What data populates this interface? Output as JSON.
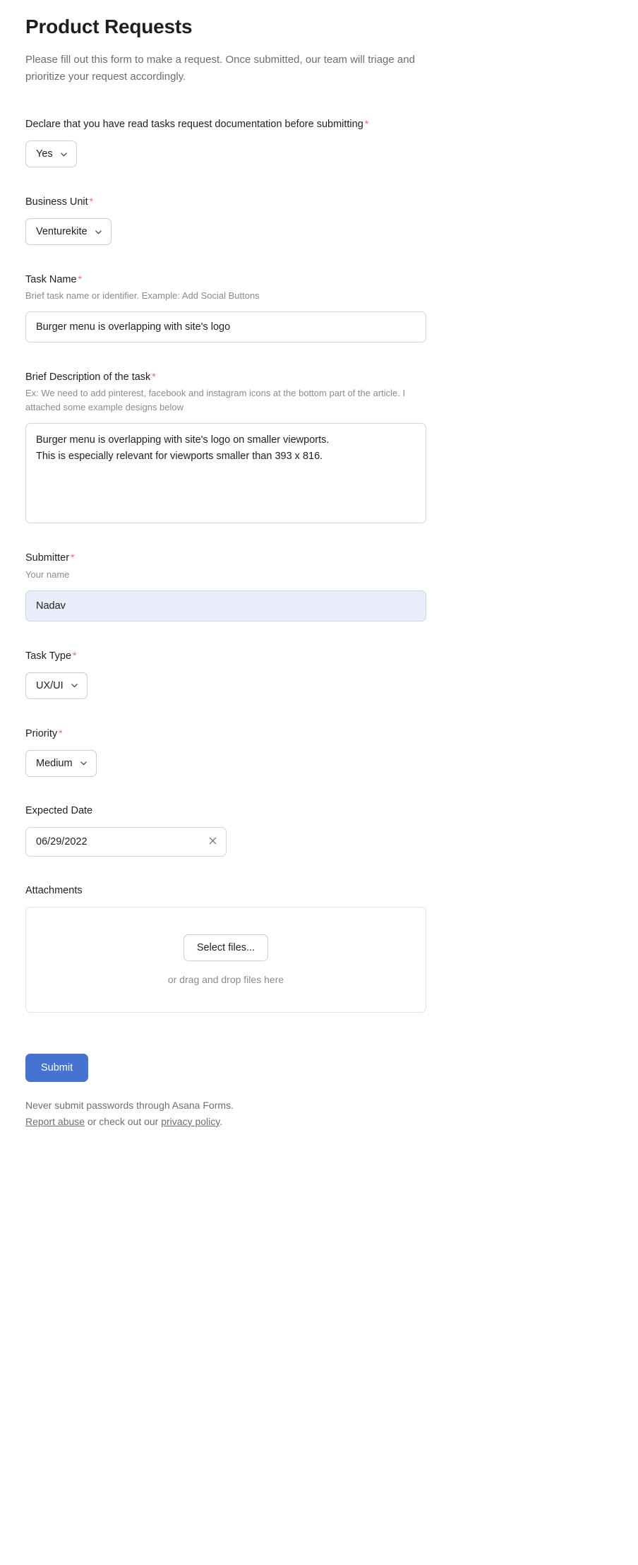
{
  "header": {
    "title": "Product Requests",
    "description": "Please fill out this form to make a request. Once submitted, our team will triage and prioritize your request accordingly."
  },
  "theme": {
    "accent": "#4573d2",
    "required_marker_color": "#f06a6a",
    "filled_input_bg": "#e8edf9",
    "page_bg": "#ffffff",
    "text_primary": "#1e1f21",
    "text_secondary": "#6d6e6f"
  },
  "required_marker": "*",
  "fields": {
    "declare": {
      "label": "Declare that you have read tasks request documentation before submitting",
      "required": true,
      "type": "select",
      "value": "Yes"
    },
    "business_unit": {
      "label": "Business Unit",
      "required": true,
      "type": "select",
      "value": "Venturekite"
    },
    "task_name": {
      "label": "Task Name",
      "required": true,
      "type": "text",
      "help": "Brief task name or identifier. Example: Add Social Buttons",
      "value": "Burger menu is overlapping with site's logo",
      "placeholder": ""
    },
    "description": {
      "label": "Brief Description of the task",
      "required": true,
      "type": "textarea",
      "help": "Ex: We need to add pinterest, facebook and instagram icons at the bottom part of the article. I attached some example designs below",
      "value": "Burger menu is overlapping with site's logo on smaller viewports.\nThis is especially relevant for viewports smaller than 393 x 816.",
      "placeholder": ""
    },
    "submitter": {
      "label": "Submitter",
      "required": true,
      "type": "text",
      "help": "Your name",
      "value": "Nadav",
      "placeholder": "Your name"
    },
    "task_type": {
      "label": "Task Type",
      "required": true,
      "type": "select",
      "value": "UX/UI"
    },
    "priority": {
      "label": "Priority",
      "required": true,
      "type": "select",
      "value": "Medium"
    },
    "expected_date": {
      "label": "Expected Date",
      "required": false,
      "type": "date",
      "value": "06/29/2022",
      "clear_icon": "close-icon"
    },
    "attachments": {
      "label": "Attachments",
      "required": false,
      "type": "file",
      "select_button": "Select files...",
      "drop_hint": "or drag and drop files here"
    }
  },
  "footer": {
    "submit_label": "Submit",
    "warning": "Never submit passwords through Asana Forms.",
    "report_abuse": "Report abuse",
    "legal_middle": " or check out our ",
    "privacy_policy": "privacy policy",
    "legal_end": "."
  },
  "icons": {
    "chevron_down": "chevron-down-icon",
    "close": "close-icon"
  }
}
